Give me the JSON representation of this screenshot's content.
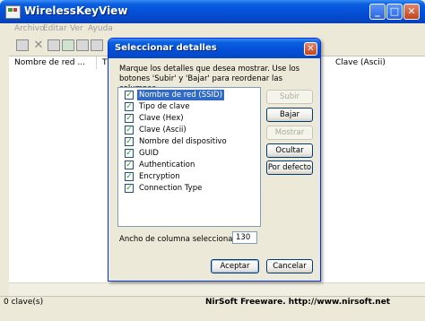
{
  "app": {
    "title": "WirelessKeyView"
  },
  "window_controls": {
    "minimize": "_",
    "maximize": "□",
    "close": "✕"
  },
  "menu": [
    "Archivo",
    "Editar",
    "Ver",
    "Ayuda"
  ],
  "toolbar": {
    "icons": [
      "save-icon",
      "delete-icon",
      "copy-icon",
      "refresh-icon",
      "report-icon",
      "properties-icon"
    ]
  },
  "list": {
    "columns": [
      "Nombre de red ...",
      "Tipo",
      "Clave (Ascii)"
    ],
    "rows": []
  },
  "status": {
    "count": "0 clave(s)",
    "nirsoft": "NirSoft Freeware.  http://www.nirsoft.net"
  },
  "dialog": {
    "title": "Seleccionar detalles",
    "close": "✕",
    "description": "Marque los detalles que desea mostrar. Use los botones 'Subir' y 'Bajar' para reordenar las columnas.",
    "items": [
      {
        "label": "Nombre de red (SSID)",
        "checked": true,
        "selected": true
      },
      {
        "label": "Tipo de clave",
        "checked": true,
        "selected": false
      },
      {
        "label": "Clave (Hex)",
        "checked": true,
        "selected": false
      },
      {
        "label": "Clave (Ascii)",
        "checked": true,
        "selected": false
      },
      {
        "label": "Nombre del dispositivo",
        "checked": true,
        "selected": false
      },
      {
        "label": "GUID",
        "checked": true,
        "selected": false
      },
      {
        "label": "Authentication",
        "checked": true,
        "selected": false
      },
      {
        "label": "Encryption",
        "checked": true,
        "selected": false
      },
      {
        "label": "Connection Type",
        "checked": true,
        "selected": false
      }
    ],
    "buttons": {
      "up": "Subir",
      "down": "Bajar",
      "show": "Mostrar",
      "hide": "Ocultar",
      "default": "Por defecto",
      "accept": "Aceptar",
      "cancel": "Cancelar"
    },
    "column_width_label": "Ancho de columna seleccionada",
    "column_width_value": "130"
  }
}
